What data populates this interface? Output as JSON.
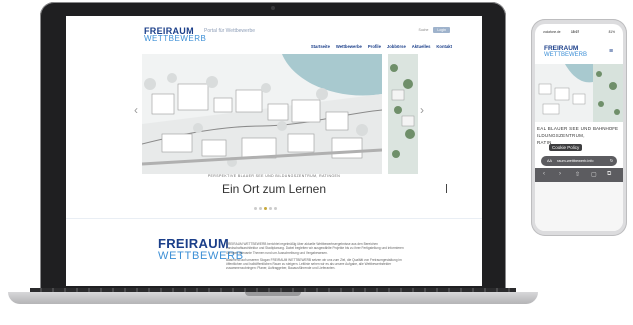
{
  "site": {
    "logo_line1": "FREIRAUM",
    "logo_line2": "WETTBEWERB",
    "tagline": "Portal für Wettbewerbe",
    "utility_link": "Suche",
    "login_label": "Login",
    "nav": [
      "Startseite",
      "Wettbewerbe",
      "Profile",
      "Jobbörse",
      "Aktuelles",
      "Kontakt"
    ]
  },
  "hero": {
    "caption": "PERSPEKTIVE BLAUER SEE UND BILDUNGSZENTRUM, RATINGEN",
    "headline": "Ein Ort zum Lernen",
    "prev_arrow": "‹",
    "next_arrow": "›",
    "slides": 5,
    "active_slide": 3
  },
  "intro": {
    "logo_line1": "FREIRAUM",
    "logo_line2": "WETTBEWERB",
    "paragraph1": "FREIRAUM WETTBEWERB berichtet regelmäßig über aktuelle Wettbewerbsergebnisse aus den Bereichen Landschaftsarchitektur und Stadtplanung. Dabei begleiten wir ausgewählte Projekte bis zu ihrer Fertigstellung und informieren Sie über relevante Themen rund um Ausschreibung und Vergabewesen.",
    "paragraph2": "Basierend auf unserem Slogan FREIRAUM WETTBEWERB setzen wir uns zum Ziel, die Qualität von Freiraumgestaltung im öffentlichen und halböffentlichen Raum zu steigern. Leitlinie sehen wir es als unsere Aufgabe, alle Wettbewerbsfelder zusammenzubringen: Planer, Auftraggeber, Bauausführende und Lieferanten."
  },
  "phone": {
    "status_left": "vodafone.de",
    "status_time": "15:07",
    "status_right": "81%",
    "hamburger": "≡",
    "hero_line1": "EAL BLAUER SEE UND",
    "hero_line2": "ILDUNGSZENTRUM,",
    "hero_line3": "RATIN",
    "hero_side": "BAHNHOFE",
    "cookie_label": "Cookie Policy",
    "url_aa": "AA",
    "url_domain": "raum-wettbewerb.info",
    "url_reload": "↻",
    "toolbar": [
      "‹",
      "›",
      "⇧",
      "▢",
      "⧉"
    ]
  },
  "colors": {
    "brand_dark": "#1b3f8a",
    "brand_light": "#3c8fd6",
    "dot_active": "#c9a93a"
  }
}
